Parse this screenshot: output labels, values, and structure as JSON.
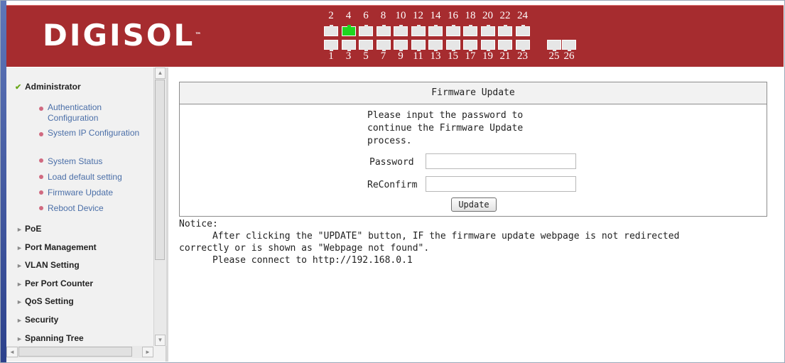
{
  "header": {
    "brand": "DIGISOL",
    "trademark": "™",
    "ports_top": [
      "2",
      "4",
      "6",
      "8",
      "10",
      "12",
      "14",
      "16",
      "18",
      "20",
      "22",
      "24"
    ],
    "ports_bottom": [
      "1",
      "3",
      "5",
      "7",
      "9",
      "11",
      "13",
      "15",
      "17",
      "19",
      "21",
      "23"
    ],
    "ports_extra": [
      "25",
      "26"
    ],
    "active_port": "4",
    "active_color": "#1fd61f"
  },
  "sidebar": {
    "administrator": "Administrator",
    "subitems": [
      "Authentication Configuration",
      "System IP Configuration",
      "System Status",
      "Load default setting",
      "Firmware Update",
      "Reboot Device"
    ],
    "sections": [
      "PoE",
      "Port Management",
      "VLAN Setting",
      "Per Port Counter",
      "QoS Setting",
      "Security",
      "Spanning Tree"
    ]
  },
  "main": {
    "panel_title": "Firmware Update",
    "message": "Please input the password to continue the Firmware Update process.",
    "password_label": "Password",
    "reconfirm_label": "ReConfirm",
    "update_button": "Update",
    "notice_title": "Notice:",
    "notice_line1": "      After clicking the \"UPDATE\" button, IF the firmware update webpage is not redirected",
    "notice_line2": "correctly or is shown as \"Webpage not found\".",
    "notice_line3": "      Please connect to http://192.168.0.1"
  },
  "colors": {
    "header_bg": "#a62c2f",
    "link": "#4b6fa8"
  }
}
